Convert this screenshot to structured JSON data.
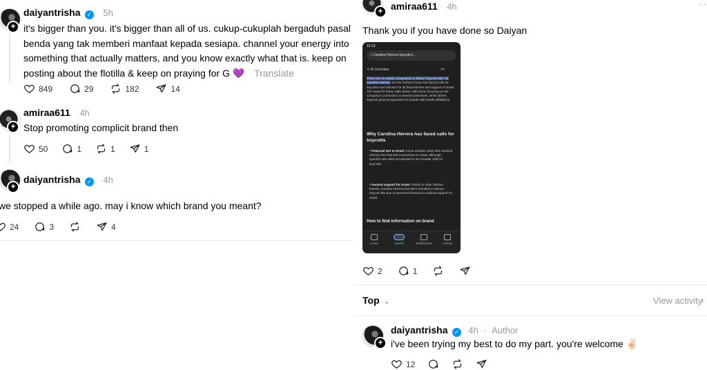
{
  "left_thread": {
    "post1": {
      "username": "daiyantrisha",
      "time": "5h",
      "lines": [
        "it's bigger than you. it's bigger than all of us. cukup-cukuplah bergaduh pasal",
        "benda yang tak memberi manfaat kepada sesiapa. channel your energy into",
        "something that actually matters, and you know exactly what that is. keep on",
        "posting about the flotilla & keep on praying for G"
      ],
      "emoji": "💜",
      "translate": "Translate",
      "likes": "849",
      "comments": "29",
      "reposts": "182",
      "shares": "14"
    },
    "post2": {
      "username": "amiraa611",
      "time": "4h",
      "text": "Stop promoting complicit brand then",
      "likes": "50",
      "comments": "1",
      "reposts": "1",
      "shares": "1"
    },
    "post3": {
      "username": "daiyantrisha",
      "time": "4h",
      "text": "we stopped a while ago. may i know which brand you meant?",
      "likes": "24",
      "comments": "3",
      "shares": "4"
    }
  },
  "right_thread": {
    "post": {
      "username": "amiraa611",
      "time": "4h",
      "text": "Thank you if you have done so Daiyan",
      "likes": "2",
      "comments": "1",
      "more": "···"
    },
    "phone": {
      "status_time": "12:13",
      "search_query": "Carolina Herrera boycott li...",
      "ai_overview_label": "AI Overview",
      "ai_count": "+4",
      "highlight": "There are no widely recognized or official \"boycott lists\" for Carolina Herrera",
      "para1_rest": ", but the fashion house has faced calls for boycotts and criticism for its financial ties and support of Israel. The basis for these calls varies, with some focusing on the company's connection to Israeli businesses, while others express general opposition to brands with Israeli affiliations.",
      "heading1": "Why Carolina Herrera has faced calls for boycotts",
      "bullet1_title": "Financial ties to Israel:",
      "bullet1_text": " Some activists claim that Carolina Herrera has financial connections to Israel, although specifics are often not detailed in the broader calls for boycotts.",
      "bullet2_title": "General support for Israel:",
      "bullet2_text": " Similar to other fashion brands, Carolina Herrera has been included in various boycott lists due to perceived financial or political support for Israel.",
      "heading2": "How to find information on brand",
      "nav": [
        "Home",
        "Search",
        "Notifications",
        "Activity"
      ]
    },
    "sort": {
      "label": "Top",
      "view_activity": "View activity"
    },
    "reply": {
      "username": "daiyantrisha",
      "time": "4h",
      "separator": "·",
      "author_label": "Author",
      "text": "i've been trying my best to do my part. you're welcome",
      "emoji": "✌🏻",
      "likes": "12"
    }
  },
  "colors": {
    "verified": "#0095f6",
    "muted": "#999999",
    "highlight": "#3d4f8a"
  },
  "icons": [
    "heart-icon",
    "comment-icon",
    "repost-icon",
    "share-icon",
    "verified-icon",
    "plus-icon",
    "more-icon",
    "chevron-down-icon"
  ]
}
